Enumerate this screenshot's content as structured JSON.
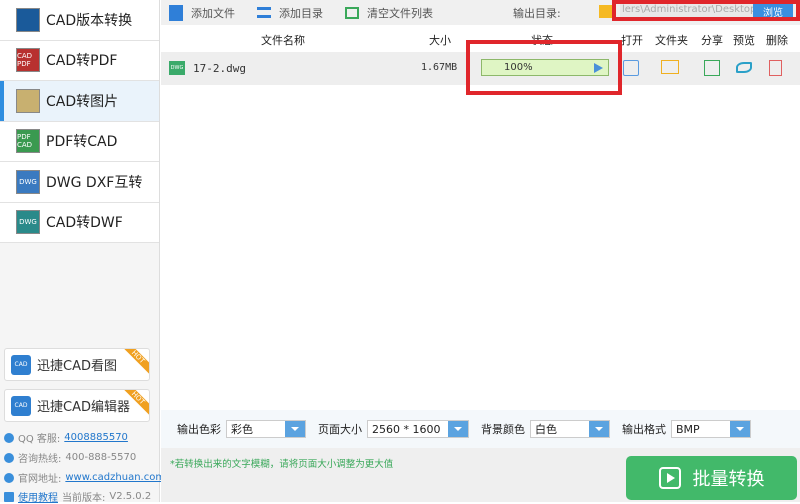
{
  "sidebar": {
    "items": [
      {
        "label": "CAD版本转换",
        "icon": "cad-version-icon",
        "color": "#1a5a9a",
        "tag": ""
      },
      {
        "label": "CAD转PDF",
        "icon": "cad-to-pdf-icon",
        "color": "#b8312f",
        "tag": "CAD PDF"
      },
      {
        "label": "CAD转图片",
        "icon": "cad-to-image-icon",
        "color": "#c8b070",
        "tag": ""
      },
      {
        "label": "PDF转CAD",
        "icon": "pdf-to-cad-icon",
        "color": "#3a9a50",
        "tag": "PDF CAD"
      },
      {
        "label": "DWG DXF互转",
        "icon": "dwg-dxf-icon",
        "color": "#3a7ac0",
        "tag": "DWG"
      },
      {
        "label": "CAD转DWF",
        "icon": "cad-to-dwf-icon",
        "color": "#2a8a8a",
        "tag": "DWG"
      }
    ],
    "selected": 2,
    "promos": [
      {
        "label": "迅捷CAD看图",
        "badge": "HOT",
        "icon_text": "CAD"
      },
      {
        "label": "迅捷CAD编辑器",
        "badge": "HOT",
        "icon_text": "CAD"
      }
    ],
    "qq_label": "QQ 客服:",
    "qq": "4008885570",
    "hotline_label": "咨询热线:",
    "hotline": "400-888-5570",
    "site_label": "官网地址:",
    "site": "www.cadzhuan.com",
    "tutorial": "使用教程",
    "version_label": "当前版本:",
    "version": "V2.5.0.2"
  },
  "toolbar": {
    "add_file": "添加文件",
    "add_dir": "添加目录",
    "clear": "清空文件列表",
    "output_label": "输出目录:",
    "output_path": "lers\\Administrator\\Desktop",
    "browse": "浏览"
  },
  "table": {
    "headers": {
      "name": "文件名称",
      "size": "大小",
      "status": "状态",
      "open": "打开",
      "folder": "文件夹",
      "share": "分享",
      "preview": "预览",
      "delete": "删除"
    },
    "rows": [
      {
        "icon_text": "DWG",
        "name": "17-2.dwg",
        "size": "1.67MB",
        "progress_text": "100%",
        "progress": 100
      }
    ]
  },
  "options": {
    "color_label": "输出色彩",
    "color": "彩色",
    "page_label": "页面大小",
    "page": "2560 * 1600",
    "bg_label": "背景颜色",
    "bg": "白色",
    "format_label": "输出格式",
    "format": "BMP"
  },
  "footer": {
    "note": "*若转换出来的文字模糊，请将页面大小调整为更大值",
    "convert": "批量转换"
  }
}
